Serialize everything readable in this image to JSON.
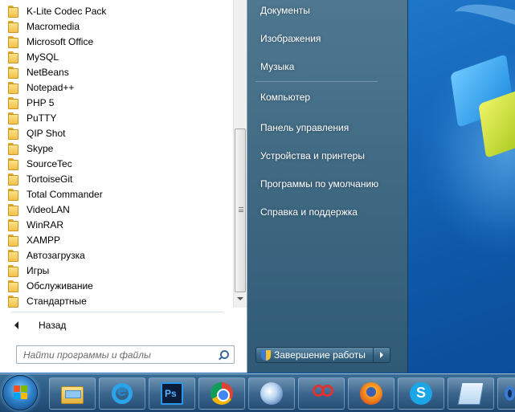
{
  "start_menu": {
    "programs": [
      "K-Lite Codec Pack",
      "Macromedia",
      "Microsoft Office",
      "MySQL",
      "NetBeans",
      "Notepad++",
      "PHP 5",
      "PuTTY",
      "QIP Shot",
      "Skype",
      "SourceTec",
      "TortoiseGit",
      "Total Commander",
      "VideoLAN",
      "WinRAR",
      "XAMPP",
      "Автозагрузка",
      "Игры",
      "Обслуживание",
      "Стандартные"
    ],
    "back_label": "Назад",
    "search_placeholder": "Найти программы и файлы",
    "right_items": [
      "Документы",
      "Изображения",
      "Музыка",
      "Компьютер",
      "Панель управления",
      "Устройства и принтеры",
      "Программы по умолчанию",
      "Справка и поддержка"
    ],
    "shutdown_label": "Завершение работы"
  },
  "taskbar": {
    "buttons": [
      {
        "name": "explorer",
        "icon": "folder-explorer-icon"
      },
      {
        "name": "internet-explorer",
        "icon": "internet-explorer-icon"
      },
      {
        "name": "photoshop",
        "icon": "photoshop-icon"
      },
      {
        "name": "chrome",
        "icon": "chrome-icon"
      },
      {
        "name": "thunderbird",
        "icon": "thunderbird-icon"
      },
      {
        "name": "snipping-tool",
        "icon": "scissors-icon"
      },
      {
        "name": "firefox",
        "icon": "firefox-icon"
      },
      {
        "name": "skype",
        "icon": "skype-icon"
      },
      {
        "name": "notepad",
        "icon": "notepad-icon"
      }
    ]
  },
  "colors": {
    "menu_right_bg": "#3c6680",
    "taskbar_bg": "#1e466e",
    "desktop_bg": "#1a6fc2"
  }
}
